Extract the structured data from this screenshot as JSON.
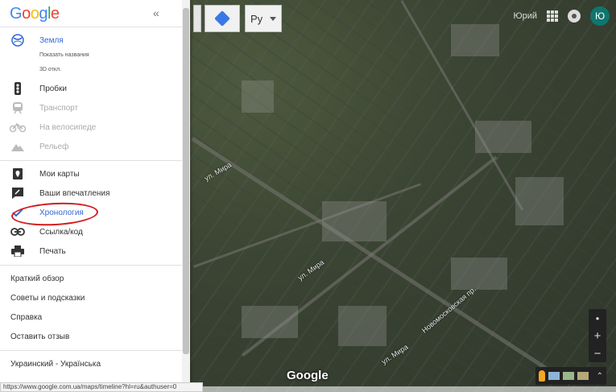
{
  "app": {
    "logo": "Google"
  },
  "sidebar": {
    "collapse_label": "«",
    "earth": {
      "label": "Земля",
      "show_names": "Показать названия",
      "tilt": "3D откл."
    },
    "layers": [
      {
        "label": "Пробки",
        "icon": "traffic-light-icon",
        "disabled": false
      },
      {
        "label": "Транспорт",
        "icon": "train-icon",
        "disabled": true
      },
      {
        "label": "На велосипеде",
        "icon": "bicycle-icon",
        "disabled": true
      },
      {
        "label": "Рельеф",
        "icon": "terrain-icon",
        "disabled": true
      }
    ],
    "tools": [
      {
        "label": "Мои карты",
        "icon": "map-pin-icon"
      },
      {
        "label": "Ваши впечатления",
        "icon": "review-icon"
      },
      {
        "label": "Хронология",
        "icon": "check-icon"
      },
      {
        "label": "Ссылка/код",
        "icon": "link-icon"
      },
      {
        "label": "Печать",
        "icon": "printer-icon"
      }
    ],
    "help_links": [
      "Краткий обзор",
      "Советы и подсказки",
      "Справка",
      "Оставить отзыв"
    ],
    "language": "Украинский - Українська"
  },
  "map": {
    "language_selector": "Ру",
    "top_right_label": "Юрий",
    "avatar_letter": "Ю",
    "google_watermark": "Google",
    "zoom_in": "+",
    "zoom_out": "−",
    "compass": "●",
    "expand": "⌃",
    "street_labels": [
      "ул. Мира",
      "ул. Мира",
      "ул. Мира",
      "Новомосковская пр."
    ]
  },
  "status_bar_url": "https://www.google.com.ua/maps/timeline?hl=ru&authuser=0",
  "colors": {
    "link": "#3367d6",
    "highlight_circle": "#d21a1a",
    "avatar": "#0f766e"
  }
}
